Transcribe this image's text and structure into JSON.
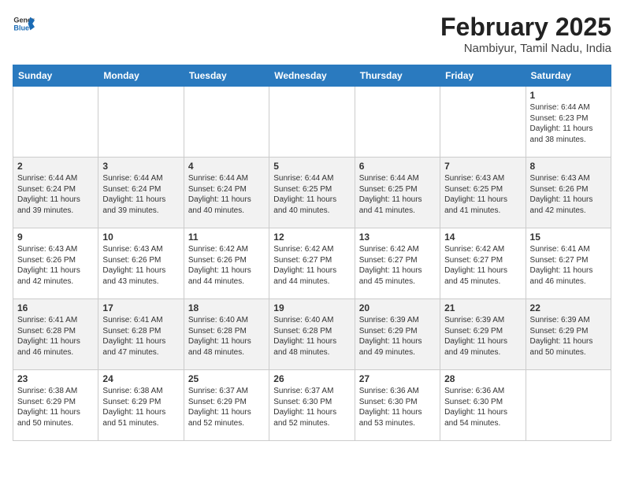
{
  "header": {
    "logo_general": "General",
    "logo_blue": "Blue",
    "month_year": "February 2025",
    "location": "Nambiyur, Tamil Nadu, India"
  },
  "days_of_week": [
    "Sunday",
    "Monday",
    "Tuesday",
    "Wednesday",
    "Thursday",
    "Friday",
    "Saturday"
  ],
  "weeks": [
    [
      {
        "day": "",
        "info": ""
      },
      {
        "day": "",
        "info": ""
      },
      {
        "day": "",
        "info": ""
      },
      {
        "day": "",
        "info": ""
      },
      {
        "day": "",
        "info": ""
      },
      {
        "day": "",
        "info": ""
      },
      {
        "day": "1",
        "info": "Sunrise: 6:44 AM\nSunset: 6:23 PM\nDaylight: 11 hours\nand 38 minutes."
      }
    ],
    [
      {
        "day": "2",
        "info": "Sunrise: 6:44 AM\nSunset: 6:24 PM\nDaylight: 11 hours\nand 39 minutes."
      },
      {
        "day": "3",
        "info": "Sunrise: 6:44 AM\nSunset: 6:24 PM\nDaylight: 11 hours\nand 39 minutes."
      },
      {
        "day": "4",
        "info": "Sunrise: 6:44 AM\nSunset: 6:24 PM\nDaylight: 11 hours\nand 40 minutes."
      },
      {
        "day": "5",
        "info": "Sunrise: 6:44 AM\nSunset: 6:25 PM\nDaylight: 11 hours\nand 40 minutes."
      },
      {
        "day": "6",
        "info": "Sunrise: 6:44 AM\nSunset: 6:25 PM\nDaylight: 11 hours\nand 41 minutes."
      },
      {
        "day": "7",
        "info": "Sunrise: 6:43 AM\nSunset: 6:25 PM\nDaylight: 11 hours\nand 41 minutes."
      },
      {
        "day": "8",
        "info": "Sunrise: 6:43 AM\nSunset: 6:26 PM\nDaylight: 11 hours\nand 42 minutes."
      }
    ],
    [
      {
        "day": "9",
        "info": "Sunrise: 6:43 AM\nSunset: 6:26 PM\nDaylight: 11 hours\nand 42 minutes."
      },
      {
        "day": "10",
        "info": "Sunrise: 6:43 AM\nSunset: 6:26 PM\nDaylight: 11 hours\nand 43 minutes."
      },
      {
        "day": "11",
        "info": "Sunrise: 6:42 AM\nSunset: 6:26 PM\nDaylight: 11 hours\nand 44 minutes."
      },
      {
        "day": "12",
        "info": "Sunrise: 6:42 AM\nSunset: 6:27 PM\nDaylight: 11 hours\nand 44 minutes."
      },
      {
        "day": "13",
        "info": "Sunrise: 6:42 AM\nSunset: 6:27 PM\nDaylight: 11 hours\nand 45 minutes."
      },
      {
        "day": "14",
        "info": "Sunrise: 6:42 AM\nSunset: 6:27 PM\nDaylight: 11 hours\nand 45 minutes."
      },
      {
        "day": "15",
        "info": "Sunrise: 6:41 AM\nSunset: 6:27 PM\nDaylight: 11 hours\nand 46 minutes."
      }
    ],
    [
      {
        "day": "16",
        "info": "Sunrise: 6:41 AM\nSunset: 6:28 PM\nDaylight: 11 hours\nand 46 minutes."
      },
      {
        "day": "17",
        "info": "Sunrise: 6:41 AM\nSunset: 6:28 PM\nDaylight: 11 hours\nand 47 minutes."
      },
      {
        "day": "18",
        "info": "Sunrise: 6:40 AM\nSunset: 6:28 PM\nDaylight: 11 hours\nand 48 minutes."
      },
      {
        "day": "19",
        "info": "Sunrise: 6:40 AM\nSunset: 6:28 PM\nDaylight: 11 hours\nand 48 minutes."
      },
      {
        "day": "20",
        "info": "Sunrise: 6:39 AM\nSunset: 6:29 PM\nDaylight: 11 hours\nand 49 minutes."
      },
      {
        "day": "21",
        "info": "Sunrise: 6:39 AM\nSunset: 6:29 PM\nDaylight: 11 hours\nand 49 minutes."
      },
      {
        "day": "22",
        "info": "Sunrise: 6:39 AM\nSunset: 6:29 PM\nDaylight: 11 hours\nand 50 minutes."
      }
    ],
    [
      {
        "day": "23",
        "info": "Sunrise: 6:38 AM\nSunset: 6:29 PM\nDaylight: 11 hours\nand 50 minutes."
      },
      {
        "day": "24",
        "info": "Sunrise: 6:38 AM\nSunset: 6:29 PM\nDaylight: 11 hours\nand 51 minutes."
      },
      {
        "day": "25",
        "info": "Sunrise: 6:37 AM\nSunset: 6:29 PM\nDaylight: 11 hours\nand 52 minutes."
      },
      {
        "day": "26",
        "info": "Sunrise: 6:37 AM\nSunset: 6:30 PM\nDaylight: 11 hours\nand 52 minutes."
      },
      {
        "day": "27",
        "info": "Sunrise: 6:36 AM\nSunset: 6:30 PM\nDaylight: 11 hours\nand 53 minutes."
      },
      {
        "day": "28",
        "info": "Sunrise: 6:36 AM\nSunset: 6:30 PM\nDaylight: 11 hours\nand 54 minutes."
      },
      {
        "day": "",
        "info": ""
      }
    ]
  ]
}
